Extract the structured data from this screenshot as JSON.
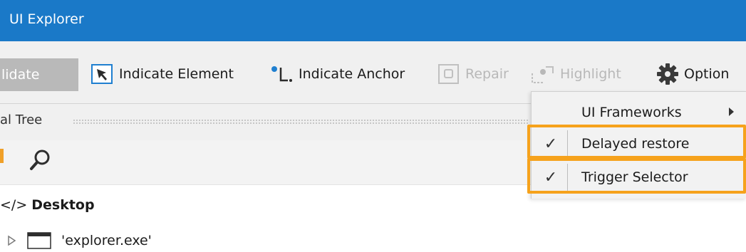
{
  "window": {
    "title": "UI Explorer"
  },
  "toolbar": {
    "validate_label": "lidate",
    "indicate_element_label": "Indicate Element",
    "indicate_anchor_label": "Indicate Anchor",
    "repair_label": "Repair",
    "highlight_label": "Highlight",
    "options_label": "Option"
  },
  "tree": {
    "header_label": "al Tree"
  },
  "nodes": {
    "desktop_code": "</>",
    "desktop_label": "Desktop",
    "explorer_label": "'explorer.exe'"
  },
  "options_menu": {
    "items": [
      {
        "label": "UI Frameworks",
        "has_submenu": true
      },
      {
        "label": "Delayed restore",
        "checked": true,
        "check_glyph": "✓"
      },
      {
        "label": "Trigger Selector",
        "checked": true,
        "check_glyph": "✓"
      }
    ]
  },
  "colors": {
    "titlebar": "#1a79c8",
    "accent": "#1f7fd0",
    "highlight_outline": "#f6a21c"
  }
}
